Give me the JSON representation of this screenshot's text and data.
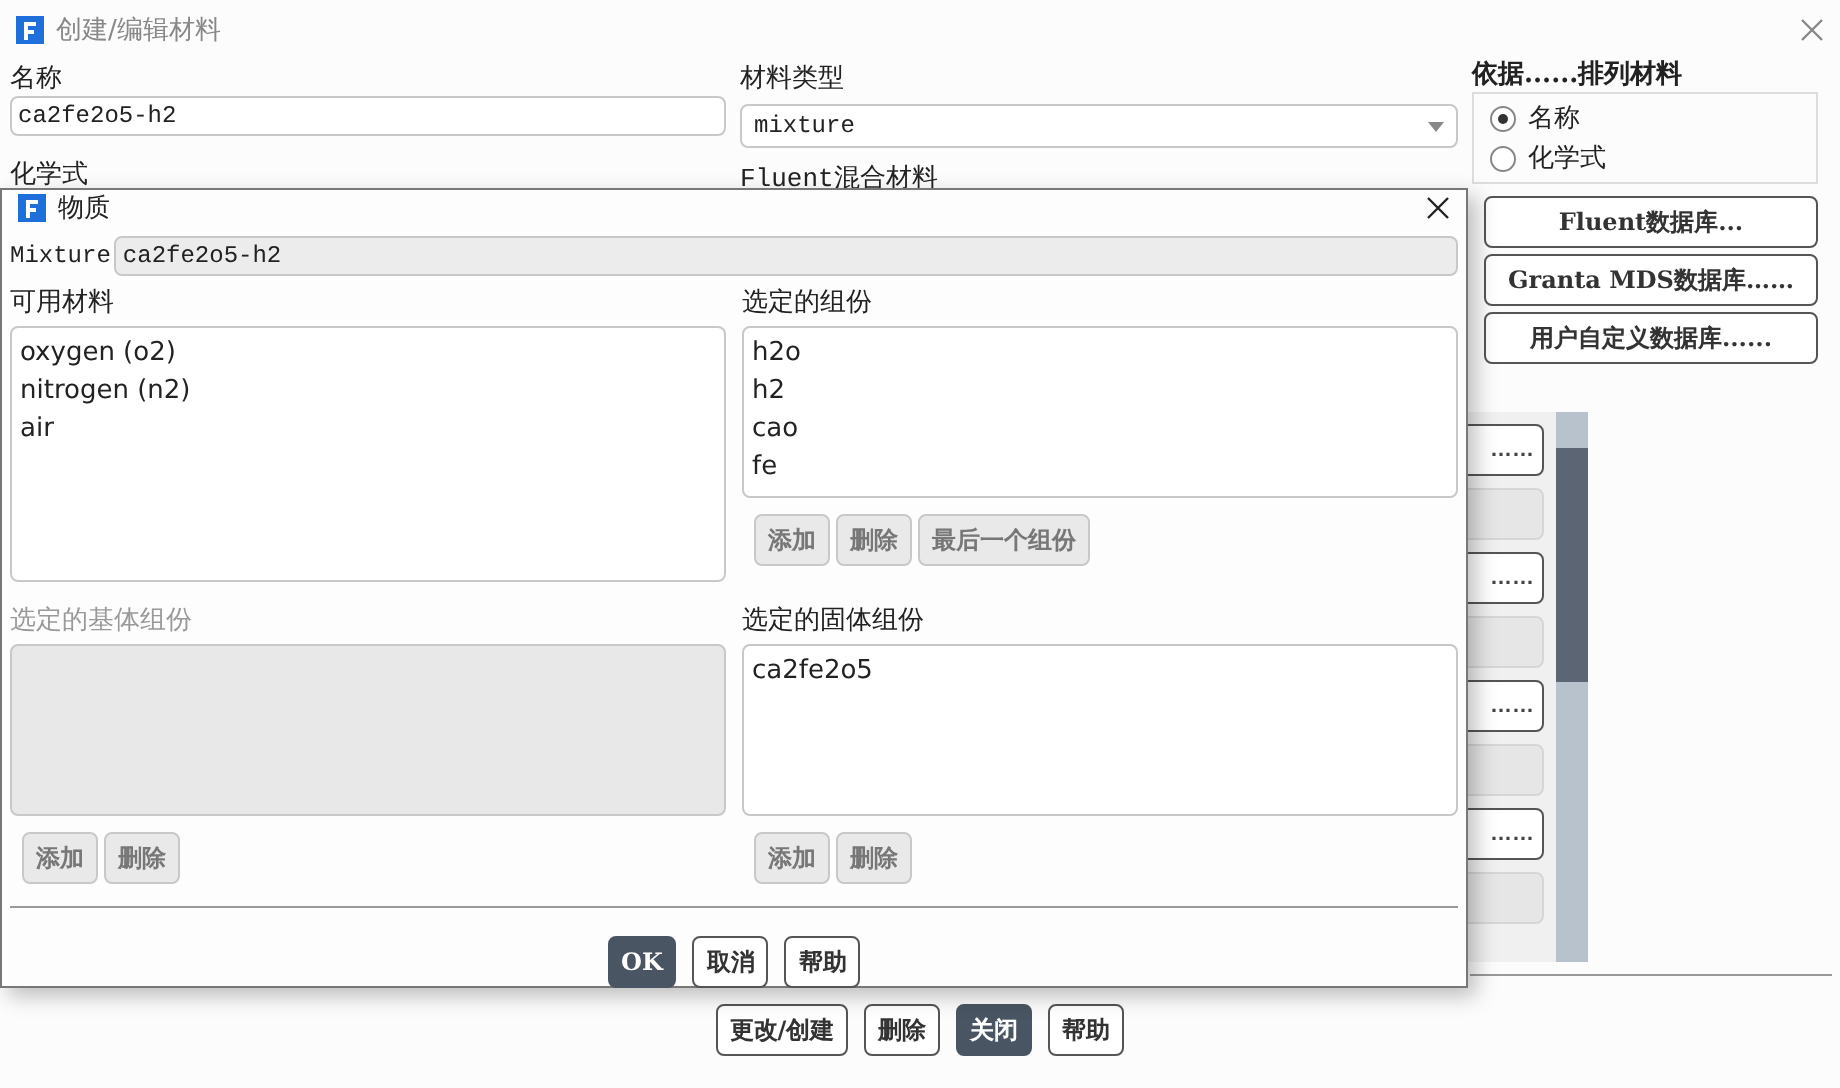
{
  "window": {
    "title": "创建/编辑材料"
  },
  "form": {
    "name_label": "名称",
    "name_value": "ca2fe2o5-h2",
    "type_label": "材料类型",
    "type_value": "mixture",
    "formula_label": "化学式",
    "mixture_label": "Fluent混合材料"
  },
  "sort": {
    "title": "依据......排列材料",
    "options": [
      {
        "label": "名称",
        "selected": true
      },
      {
        "label": "化学式",
        "selected": false
      }
    ]
  },
  "database_buttons": [
    "Fluent数据库...",
    "Granta MDS数据库……",
    "用户自定义数据库......"
  ],
  "side_list": [
    {
      "label": "……",
      "disabled": false
    },
    {
      "disabled": true
    },
    {
      "label": "……",
      "disabled": false
    },
    {
      "disabled": true
    },
    {
      "label": "……",
      "disabled": false
    },
    {
      "disabled": true
    },
    {
      "label": "……",
      "disabled": false
    },
    {
      "disabled": true
    }
  ],
  "actions": [
    {
      "label": "更改/创建",
      "primary": false
    },
    {
      "label": "删除",
      "primary": false
    },
    {
      "label": "关闭",
      "primary": true
    },
    {
      "label": "帮助",
      "primary": false
    }
  ],
  "dialog": {
    "title": "物质",
    "mixture_label": "Mixture",
    "mixture_value": "ca2fe2o5-h2",
    "available": {
      "label": "可用材料",
      "disabled": false,
      "items": [
        "oxygen (o2)",
        "nitrogen (n2)",
        "air"
      ]
    },
    "selected": {
      "label": "选定的组份",
      "disabled": false,
      "items": [
        "h2o",
        "h2",
        "cao",
        "fe"
      ],
      "buttons": [
        "添加",
        "删除",
        "最后一个组份"
      ]
    },
    "bulk": {
      "label": "选定的基体组份",
      "disabled": true,
      "buttons": [
        "添加",
        "删除"
      ]
    },
    "solid": {
      "label": "选定的固体组份",
      "disabled": false,
      "items": [
        "ca2fe2o5"
      ],
      "buttons": [
        "添加",
        "删除"
      ]
    },
    "buttons": [
      {
        "label": "OK",
        "primary": true
      },
      {
        "label": "取消",
        "primary": false
      },
      {
        "label": "帮助",
        "primary": false
      }
    ]
  }
}
